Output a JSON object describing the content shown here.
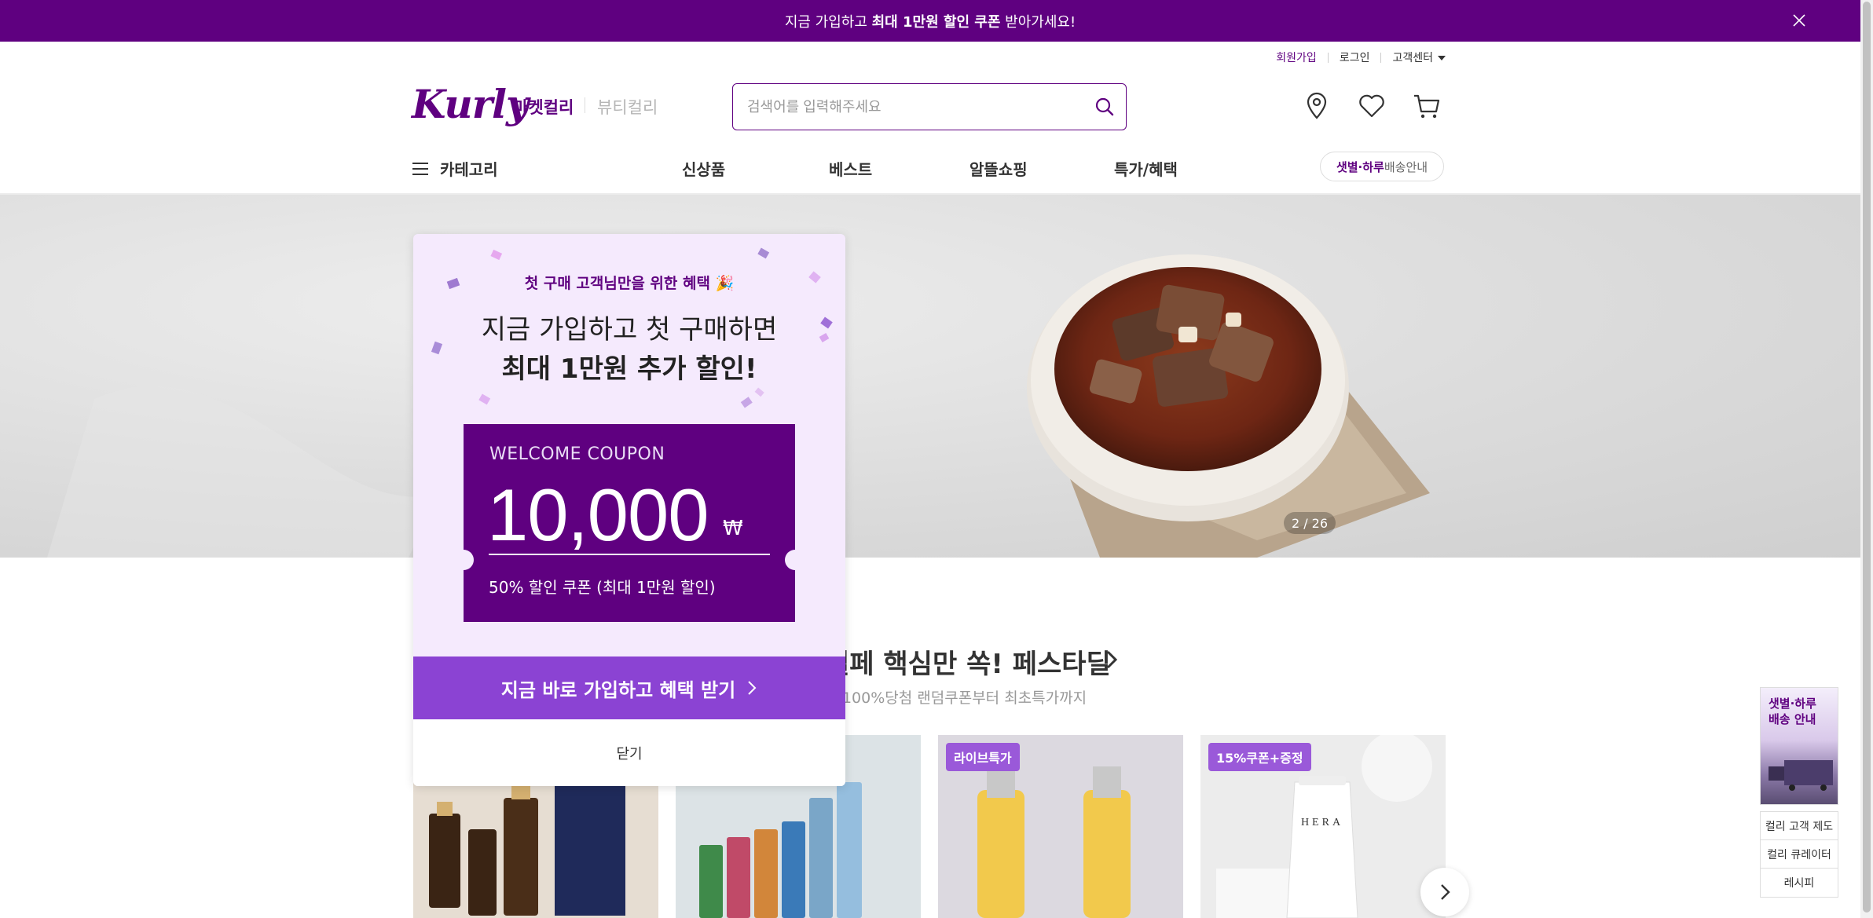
{
  "promo": {
    "text_before": "지금 가입하고 ",
    "text_bold": "최대 1만원 할인 쿠폰",
    "text_after": " 받아가세요!"
  },
  "user_menu": {
    "signup": "회원가입",
    "login": "로그인",
    "customer_center": "고객센터"
  },
  "header": {
    "logo": "Kurly",
    "tab_market": "마켓컬리",
    "tab_beauty": "뷰티컬리",
    "search_placeholder": "검색어를 입력해주세요"
  },
  "nav": {
    "category": "카테고리",
    "items": [
      "신상품",
      "베스트",
      "알뜰쇼핑",
      "특가/혜택"
    ],
    "delivery_bold": "샛별·하루",
    "delivery_rest": " 배송안내"
  },
  "hero": {
    "counter": "2 / 26"
  },
  "section": {
    "title": "설페 핵심만 쏙! 페스타딜",
    "subtitle": "> 100%당첨 랜덤쿠폰부터 최초특가까지",
    "badges": [
      "라이브특가",
      "15%쿠폰+증정"
    ]
  },
  "side_widget": {
    "banner_line1": "샛별·하루",
    "banner_line2": "배송 안내",
    "links": [
      "컬리 고객 제도",
      "컬리 큐레이터",
      "레시피"
    ]
  },
  "modal": {
    "kicker": "첫 구매 고객님만을 위한 혜택 🎉",
    "title_line1": "지금 가입하고 첫 구매하면",
    "title_line2": "최대 1만원 추가 할인!",
    "coupon_head": "WELCOME COUPON",
    "coupon_amount": "10,000",
    "coupon_currency": "₩",
    "coupon_desc": "50% 할인 쿠폰 (최대 1만원 할인)",
    "cta": "지금 바로 가입하고 혜택 받기",
    "close": "닫기"
  },
  "colors": {
    "brand": "#5f0080",
    "cta": "#8b43d3",
    "badge": "#9a59d9"
  }
}
